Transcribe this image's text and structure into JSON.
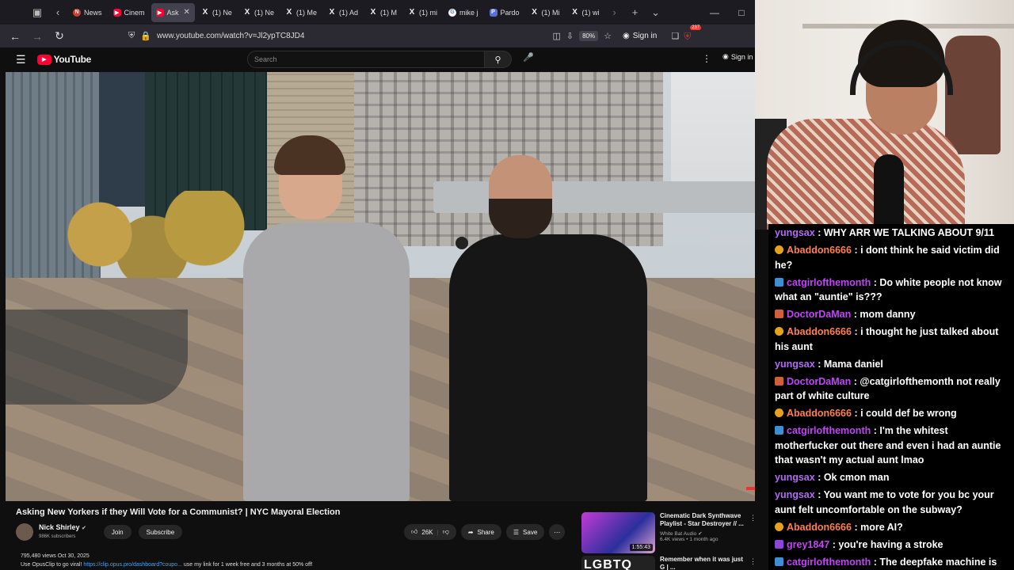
{
  "browser": {
    "tabs": [
      {
        "label": "News",
        "favicon": "news",
        "active": false
      },
      {
        "label": "Cinem",
        "favicon": "yt",
        "active": false
      },
      {
        "label": "Ask",
        "favicon": "yt",
        "active": true
      },
      {
        "label": "(1) Ne",
        "favicon": "x",
        "active": false
      },
      {
        "label": "(1) Ne",
        "favicon": "x",
        "active": false
      },
      {
        "label": "(1) Me",
        "favicon": "x",
        "active": false
      },
      {
        "label": "(1) Ad",
        "favicon": "x",
        "active": false
      },
      {
        "label": "(1) M",
        "favicon": "x",
        "active": false
      },
      {
        "label": "(1) mi",
        "favicon": "x",
        "active": false
      },
      {
        "label": "mike j",
        "favicon": "g",
        "active": false
      },
      {
        "label": "Pardo",
        "favicon": "pardon",
        "active": false
      },
      {
        "label": "(1) Mi",
        "favicon": "x",
        "active": false
      },
      {
        "label": "(1) wi",
        "favicon": "x",
        "active": false
      }
    ],
    "url": "www.youtube.com/watch?v=Jl2ypTC8JD4",
    "zoom": "80%",
    "sign_in": "Sign in",
    "extension_count": "237"
  },
  "youtube": {
    "logo_text": "YouTube",
    "search_placeholder": "Search",
    "sign_in": "Sign in",
    "video": {
      "title": "Asking New Yorkers if they Will Vote for a Communist? | NYC Mayoral Election",
      "channel": "Nick Shirley",
      "subscribers": "986K subscribers",
      "join_label": "Join",
      "subscribe_label": "Subscribe",
      "likes": "26K",
      "share_label": "Share",
      "save_label": "Save",
      "views_date": "795,480 views  Oct 30, 2025",
      "desc_prefix": "Use OpusClip to go viral! ",
      "desc_link": "https://clip.opus.pro/dashboard?coupo...",
      "desc_suffix": " use my link for 1 week free and 3 months at 50% off!"
    },
    "recommendations": [
      {
        "title": "Cinematic Dark Synthwave Playlist - Star Destroyer // ...",
        "channel": "White Bat Audio",
        "meta": "6.4K views • 1 month ago",
        "duration": "1:55:43",
        "thumb_text": ""
      },
      {
        "title": "Remember when it was just G | ...",
        "channel": "",
        "meta": "",
        "duration": "",
        "thumb_text": "LGBTQ"
      }
    ]
  },
  "chat": {
    "messages": [
      {
        "user": "yungsax",
        "color": "#b16cf0",
        "badge": "",
        "text": "WHY ARR WE TALKING ABOUT 9/11"
      },
      {
        "user": "Abaddon6666",
        "color": "#ff7f50",
        "badge": "#e6a21c",
        "text": "i dont think he said victim did he?"
      },
      {
        "user": "catgirlofthemonth",
        "color": "#c046f5",
        "badge": "#3d8fd1",
        "text": "Do white people not know what an \"auntie\" is???"
      },
      {
        "user": "DoctorDaMan",
        "color": "#c046f5",
        "badge": "#d0603a",
        "text": "mom danny"
      },
      {
        "user": "Abaddon6666",
        "color": "#ff7f50",
        "badge": "#e6a21c",
        "text": "i thought he just talked about his aunt"
      },
      {
        "user": "yungsax",
        "color": "#b16cf0",
        "badge": "",
        "text": "Mama daniel"
      },
      {
        "user": "DoctorDaMan",
        "color": "#c046f5",
        "badge": "#d0603a",
        "text": "@catgirlofthemonth not really part of white culture"
      },
      {
        "user": "Abaddon6666",
        "color": "#ff7f50",
        "badge": "#e6a21c",
        "text": "i could def be wrong"
      },
      {
        "user": "catgirlofthemonth",
        "color": "#c046f5",
        "badge": "#3d8fd1",
        "text": "I'm the whitest motherfucker out there and even i had an auntie that wasn't my actual aunt lmao"
      },
      {
        "user": "yungsax",
        "color": "#b16cf0",
        "badge": "",
        "text": "Ok cmon man"
      },
      {
        "user": "yungsax",
        "color": "#b16cf0",
        "badge": "",
        "text": "You want me to vote for you bc your aunt felt uncomfortable on the subway?"
      },
      {
        "user": "Abaddon6666",
        "color": "#ff7f50",
        "badge": "#e6a21c",
        "text": "more AI?"
      },
      {
        "user": "grey1847",
        "color": "#c046f5",
        "badge": "#8f45d8",
        "text": "you're having a stroke"
      },
      {
        "user": "catgirlofthemonth",
        "color": "#c046f5",
        "badge": "#3d8fd1",
        "text": "The deepfake machine is on the fritz"
      }
    ]
  }
}
